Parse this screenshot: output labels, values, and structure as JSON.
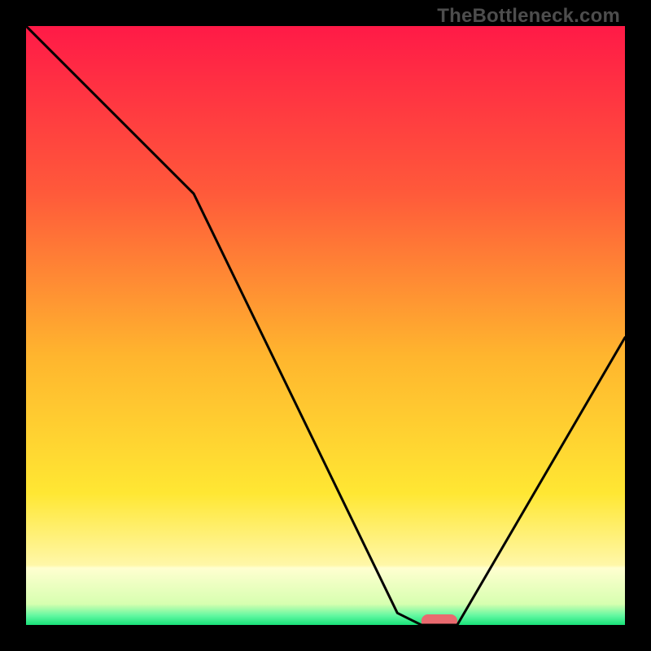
{
  "watermark": "TheBottleneck.com",
  "gradient": {
    "top": "#ff1a47",
    "mid1": "#ff8a2a",
    "mid2": "#ffe733",
    "bottom_band": "#ffffb0",
    "green": "#18e178"
  },
  "chart_data": {
    "type": "line",
    "title": "",
    "xlabel": "",
    "ylabel": "",
    "xlim": [
      0,
      100
    ],
    "ylim": [
      0,
      100
    ],
    "series": [
      {
        "name": "bottleneck-curve",
        "x": [
          0,
          28,
          62,
          66,
          72,
          100
        ],
        "y": [
          100,
          72,
          2,
          0,
          0,
          48
        ]
      }
    ],
    "marker": {
      "x_start": 66,
      "x_end": 72,
      "y": 0,
      "color": "#e96a6f"
    }
  }
}
